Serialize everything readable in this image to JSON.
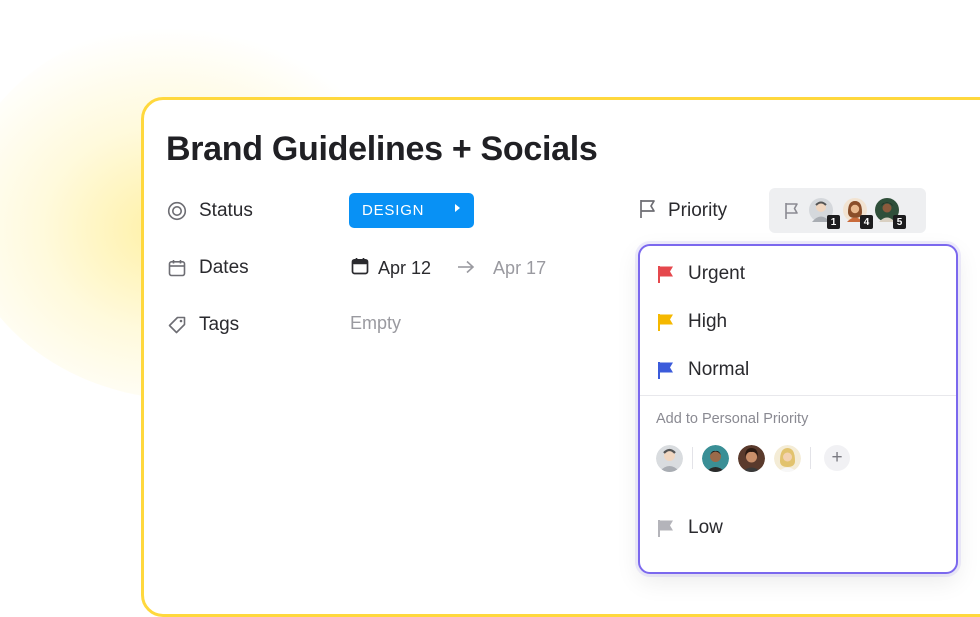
{
  "task": {
    "title": "Brand Guidelines + Socials"
  },
  "fields": {
    "status": {
      "label": "Status",
      "value": "DESIGN"
    },
    "dates": {
      "label": "Dates",
      "start": "Apr 12",
      "end": "Apr 17"
    },
    "tags": {
      "label": "Tags",
      "value": "Empty"
    },
    "priority": {
      "label": "Priority"
    }
  },
  "priority_summary": {
    "assignees": [
      {
        "count": "1",
        "avatar_color": "#c9ccd1"
      },
      {
        "count": "4",
        "avatar_color": "#b07a4e"
      },
      {
        "count": "5",
        "avatar_color": "#2f4f3a"
      }
    ]
  },
  "priority_menu": {
    "options": [
      {
        "label": "Urgent",
        "color": "#e5484d",
        "icon": "flag-icon"
      },
      {
        "label": "High",
        "color": "#f5b800",
        "icon": "flag-icon"
      },
      {
        "label": "Normal",
        "color": "#3b5bdb",
        "icon": "flag-icon"
      },
      {
        "label": "Low",
        "color": "#b4b4ba",
        "icon": "flag-icon"
      }
    ],
    "personal": {
      "title": "Add to Personal Priority",
      "people": [
        {
          "avatar_color": "#c5c8cc"
        },
        {
          "avatar_color": "#3a8f96"
        },
        {
          "avatar_color": "#5a3a2c"
        },
        {
          "avatar_color": "#e8d39a"
        }
      ],
      "add_label": "+"
    }
  },
  "colors": {
    "accent_border": "#ffd83d",
    "status_blue": "#0891f5",
    "dropdown_border": "#7b68ee"
  }
}
